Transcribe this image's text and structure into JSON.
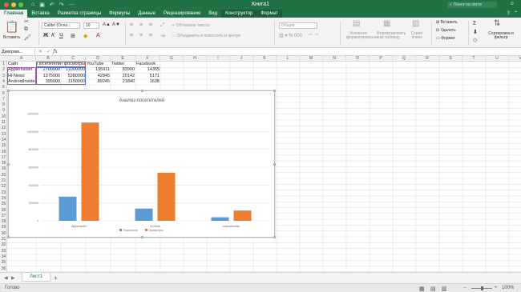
{
  "window": {
    "title": "Книга1",
    "search_placeholder": "Поиск на листе"
  },
  "tabs": [
    "Главная",
    "Вставка",
    "Разметка страницы",
    "Формулы",
    "Данные",
    "Рецензирование",
    "Вид",
    "Конструктор",
    "Формат"
  ],
  "active_tab": "Главная",
  "ribbon": {
    "paste_label": "Вставить",
    "font_name": "Calibri (Осно...",
    "font_size": "10",
    "bold": "Ж",
    "italic": "К",
    "underline": "Ч",
    "wrap_text": "Обтекание текста",
    "merge_center": "Объединить и поместить в центре",
    "number_format": "Общий",
    "conditional_formatting": "Условное форматирование",
    "format_as_table": "Форматировать как таблицу",
    "cell_styles": "Стили ячеек",
    "insert": "Вставить",
    "delete": "Удалить",
    "format": "Формат",
    "sort_filter": "Сортировка и фильтр"
  },
  "formula_bar": {
    "name_box": "Диаграм...",
    "fx": "fx",
    "value": ""
  },
  "columns": [
    "A",
    "B",
    "C",
    "D",
    "E",
    "F",
    "G",
    "H",
    "I",
    "J",
    "K",
    "L",
    "M",
    "N",
    "O",
    "P",
    "Q",
    "R",
    "S",
    "T",
    "U",
    "V"
  ],
  "rows": [
    "1",
    "2",
    "3",
    "4",
    "5",
    "6",
    "7",
    "8",
    "9",
    "10",
    "11",
    "12",
    "13",
    "14",
    "15",
    "16",
    "17",
    "18",
    "19",
    "20",
    "21",
    "22",
    "23",
    "24",
    "25",
    "26",
    "27",
    "28",
    "29",
    "30",
    "31",
    "32",
    "33",
    "34",
    "35",
    "36"
  ],
  "table": {
    "headers": [
      "Сайт",
      "Посетители",
      "Просмотры",
      "YouTube",
      "Twitter",
      "Facebook"
    ],
    "rows": [
      [
        "AppleInsider",
        "2700000",
        "11000000",
        "195911",
        "83900",
        "14355"
      ],
      [
        "Hi-News",
        "1375000",
        "5380000",
        "42845",
        "20142",
        "5171"
      ],
      [
        "AndroidInsider",
        "395000",
        "1150000",
        "89245",
        "21840",
        "1638"
      ]
    ]
  },
  "chart_data": {
    "type": "bar",
    "title": "Анализ посетителей",
    "categories": [
      "AppleInsider",
      "Hi-News",
      "AndroidInsider"
    ],
    "series": [
      {
        "name": "Посетители",
        "values": [
          2700000,
          1375000,
          395000
        ],
        "color": "#5b9bd5"
      },
      {
        "name": "Просмотры",
        "values": [
          11000000,
          5380000,
          1150000
        ],
        "color": "#ed7d31"
      }
    ],
    "yticks": [
      "12000000",
      "10000000",
      "8000000",
      "6000000",
      "4000000",
      "2000000",
      "0"
    ],
    "ylim": [
      0,
      12000000
    ],
    "grid": true,
    "legend": "bottom"
  },
  "sheets": [
    "Лист1"
  ],
  "status": {
    "ready": "Готово",
    "zoom": "100%",
    "zoom_fraction": 0.5
  },
  "colors": {
    "accent": "#207245",
    "series1": "#5b9bd5",
    "series2": "#ed7d31"
  }
}
